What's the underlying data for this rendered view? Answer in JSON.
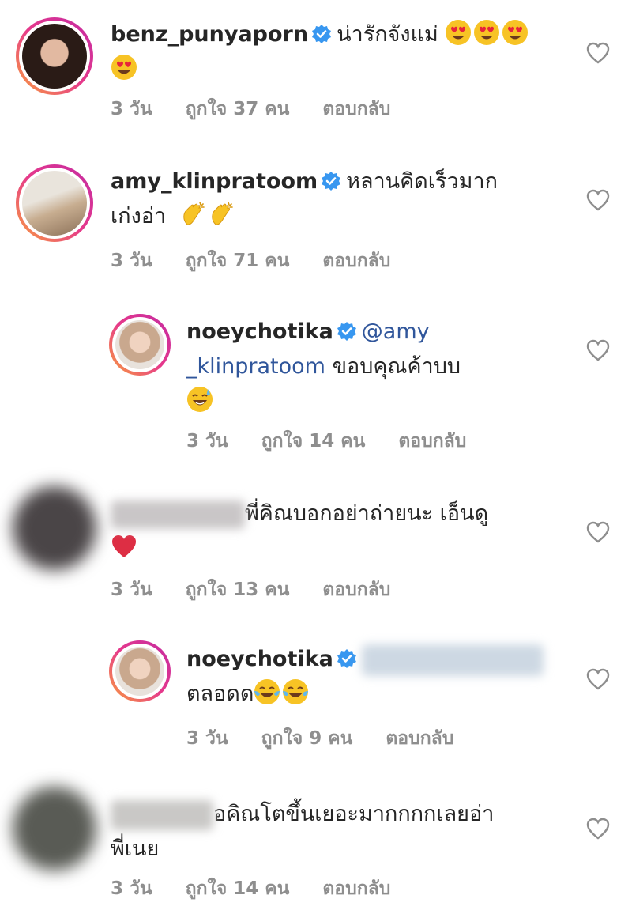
{
  "comments": [
    {
      "username": "benz_punyaporn",
      "text": "น่ารักจังแม่",
      "time": "3 วัน",
      "likes": "ถูกใจ 37 คน",
      "reply": "ตอบกลับ"
    },
    {
      "username": "amy_klinpratoom",
      "text_line1": "หลานคิดเร็วมาก",
      "text_line2": "เก่งอ่า",
      "time": "3 วัน",
      "likes": "ถูกใจ 71 คน",
      "reply": "ตอบกลับ"
    },
    {
      "username": "noeychotika",
      "mention_line1": "@amy",
      "mention_line2": "_klinpratoom",
      "text": "ขอบคุณค้าบบ",
      "time": "3 วัน",
      "likes": "ถูกใจ 14 คน",
      "reply": "ตอบกลับ"
    },
    {
      "username": "",
      "text": "พี่คิณบอกอย่าถ่ายนะ เอ็นดู",
      "time": "3 วัน",
      "likes": "ถูกใจ 13 คน",
      "reply": "ตอบกลับ"
    },
    {
      "username": "noeychotika",
      "text": "ตลอดด",
      "time": "3 วัน",
      "likes": "ถูกใจ 9 คน",
      "reply": "ตอบกลับ"
    },
    {
      "username": "",
      "text_line1": "อคิณโตขึ้นเยอะมากกกกเลยอ่า",
      "text_line2": "พี่เนย",
      "time": "3 วัน",
      "likes": "ถูกใจ 14 คน",
      "reply": "ตอบกลับ"
    }
  ],
  "colors": {
    "mention": "#30569b",
    "meta": "#8e8e8e",
    "verified": "#3897f0"
  }
}
